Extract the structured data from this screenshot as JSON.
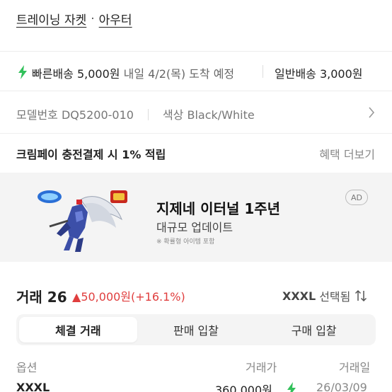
{
  "breadcrumb": {
    "category": "트레이닝 자켓",
    "separator": "·",
    "subcategory": "아우터"
  },
  "shipping": {
    "fast_label": "빠른배송",
    "fast_price": "5,000원",
    "fast_eta": "내일 4/2(목) 도착 예정",
    "normal_label": "일반배송",
    "normal_price": "3,000원"
  },
  "product_info": {
    "model_label": "모델번호",
    "model_value": "DQ5200-010",
    "color_label": "색상",
    "color_value": "Black/White"
  },
  "cream_pay": {
    "text": "크림페이 충전결제 시 1% 적립",
    "more": "혜택 더보기"
  },
  "ad": {
    "badge": "AD",
    "title": "지제네 이터널 1주년",
    "subtitle": "대규모 업데이트",
    "note": "※ 확률형 아이템 포함"
  },
  "trades": {
    "label": "거래",
    "count": "26",
    "change_arrow": "▲",
    "change": "50,000원(+16.1%)",
    "size": "XXXL",
    "size_action": "선택됨"
  },
  "tabs": [
    {
      "label": "체결 거래",
      "active": true
    },
    {
      "label": "판매 입찰",
      "active": false
    },
    {
      "label": "구매 입찰",
      "active": false
    }
  ],
  "table": {
    "headers": {
      "option": "옵션",
      "price": "거래가",
      "date": "거래일"
    },
    "rows": [
      {
        "option": "XXXL",
        "price": "360,000원",
        "date": "26/03/09"
      }
    ]
  },
  "colors": {
    "accent_green": "#31c05a",
    "up_red": "#e03e3e"
  },
  "icons": [
    "lightning-icon",
    "chevron-right-icon",
    "sort-arrows-icon"
  ]
}
